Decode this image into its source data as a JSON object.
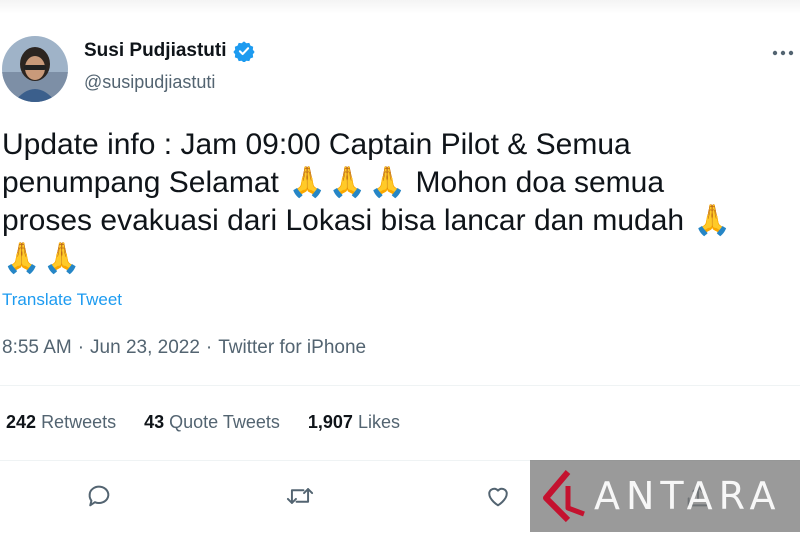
{
  "author": {
    "name": "Susi Pudjiastuti",
    "handle": "@susipudjiastuti",
    "verified": true
  },
  "tweet": {
    "line1": "Update info : Jam 09:00 Captain Pilot & Semua",
    "line2a": "penumpang Selamat ",
    "emoji": "🙏",
    "line2b": " Mohon doa semua",
    "line3": "proses evakuasi dari Lokasi bisa lancar dan mudah ",
    "translate_label": "Translate Tweet"
  },
  "meta": {
    "time": "8:55 AM",
    "separator": "·",
    "date": "Jun 23, 2022",
    "source": "Twitter for iPhone"
  },
  "stats": {
    "retweets_count": "242",
    "retweets_label": "Retweets",
    "quotes_count": "43",
    "quotes_label": "Quote Tweets",
    "likes_count": "1,907",
    "likes_label": "Likes"
  },
  "watermark": {
    "text": "ANTARA"
  },
  "colors": {
    "accent": "#1d9bf0",
    "text": "#0f1419",
    "secondary": "#536471",
    "divider": "#eff3f4"
  },
  "icons": [
    "verified-badge-icon",
    "more-icon",
    "reply-icon",
    "retweet-icon",
    "like-icon",
    "share-icon"
  ]
}
